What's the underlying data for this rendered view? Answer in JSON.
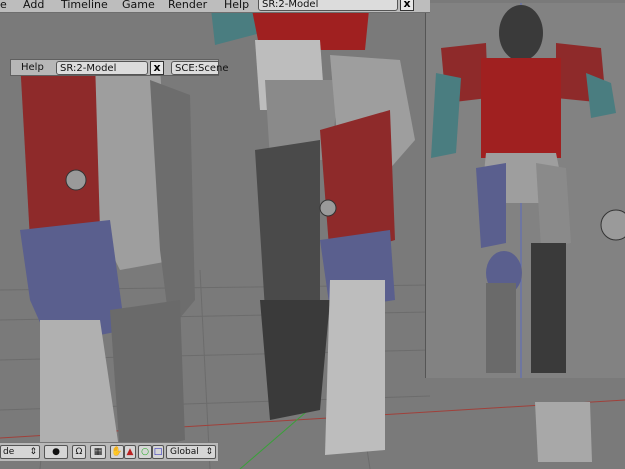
{
  "menubar": {
    "items": [
      "e",
      "Add",
      "Timeline",
      "Game",
      "Render",
      "Help"
    ],
    "scene_field": "SR:2-Model",
    "close_glyph": "x"
  },
  "sub_header": {
    "help_label": "Help",
    "scene_field": "SR:2-Model",
    "close_glyph": "x",
    "sce_field": "SCE:Scene"
  },
  "bottombar": {
    "mode_label": "de",
    "global_label": "Global"
  },
  "colors": {
    "viewport_bg": "#7a7a7a",
    "armor_red": "#8e2a2a",
    "armor_blue": "#5a5f8e",
    "armor_grey": "#bdbdbd",
    "armor_dark": "#3a3a3a"
  }
}
